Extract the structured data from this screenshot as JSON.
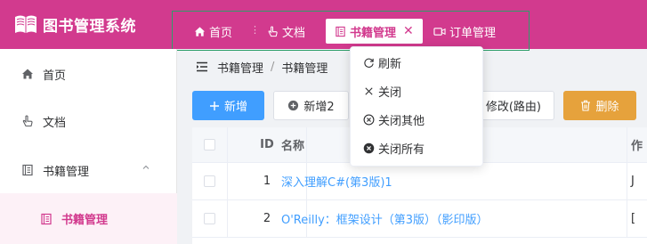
{
  "app": {
    "title": "图书管理系统"
  },
  "tabs": [
    {
      "label": "首页",
      "icon": "home-icon"
    },
    {
      "label": "文档",
      "icon": "hand-pointer-icon"
    },
    {
      "label": "书籍管理",
      "icon": "book-icon",
      "active": true
    },
    {
      "label": "订单管理",
      "icon": "video-icon"
    }
  ],
  "sidebar": {
    "items": [
      {
        "label": "首页",
        "icon": "home-icon"
      },
      {
        "label": "文档",
        "icon": "hand-pointer-icon"
      },
      {
        "label": "书籍管理",
        "icon": "book-icon",
        "expanded": true
      }
    ],
    "sub_items": [
      {
        "label": "书籍管理",
        "icon": "book-icon",
        "active": true
      }
    ]
  },
  "breadcrumb": [
    "书籍管理",
    "书籍管理"
  ],
  "toolbar": {
    "add_label": "新增",
    "add2_label": "新增2",
    "edit_route_label": "修改(路由)",
    "delete_label": "删除"
  },
  "table": {
    "columns": [
      "",
      "ID",
      "名称",
      "作"
    ],
    "rows": [
      {
        "id": "1",
        "name": "深入理解C#(第3版)1",
        "extra": "J"
      },
      {
        "id": "2",
        "name": "O'Reilly：框架设计（第3版）（影印版）",
        "extra": "["
      }
    ]
  },
  "context_menu": {
    "items": [
      {
        "label": "刷新",
        "icon": "refresh-icon"
      },
      {
        "label": "关闭",
        "icon": "close-icon"
      },
      {
        "label": "关闭其他",
        "icon": "close-circle-icon"
      },
      {
        "label": "关闭所有",
        "icon": "close-circle-filled-icon"
      }
    ]
  },
  "colors": {
    "brand": "#d23a8e",
    "primary": "#409eff",
    "warning": "#e6a23c"
  }
}
